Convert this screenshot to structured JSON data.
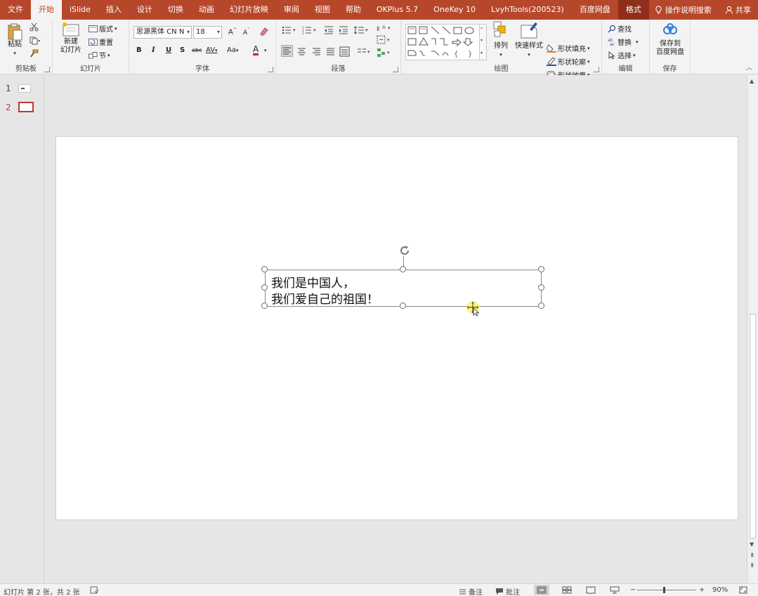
{
  "menu": {
    "tabs": [
      "文件",
      "开始",
      "iSlide",
      "插入",
      "设计",
      "切换",
      "动画",
      "幻灯片放映",
      "审阅",
      "视图",
      "帮助",
      "OKPlus 5.7",
      "OneKey 10",
      "LvyhTools(200523)",
      "百度网盘",
      "格式"
    ],
    "active_index": 1,
    "context_index": 15,
    "help_label": "操作说明搜索",
    "share_label": "共享"
  },
  "ribbon": {
    "clipboard": {
      "paste": "粘贴",
      "label": "剪贴板"
    },
    "slides": {
      "new_slide_line1": "新建",
      "new_slide_line2": "幻灯片",
      "layout": "版式",
      "reset": "重置",
      "section": "节",
      "label": "幻灯片"
    },
    "font": {
      "font_name": "思源黑体 CN N",
      "font_size": "18",
      "bold": "B",
      "italic": "I",
      "underline": "U",
      "shadow": "S",
      "strike": "abc",
      "spacing": "AV",
      "case": "Aa",
      "color": "A",
      "grow": "A",
      "shrink": "A",
      "label": "字体"
    },
    "paragraph": {
      "label": "段落"
    },
    "drawing": {
      "arrange": "排列",
      "quick_styles": "快速样式",
      "fill": "形状填充",
      "outline": "形状轮廓",
      "effects": "形状效果",
      "label": "绘图"
    },
    "editing": {
      "find": "查找",
      "replace": "替换",
      "select": "选择",
      "label": "编辑"
    },
    "save": {
      "line1": "保存到",
      "line2": "百度网盘",
      "label": "保存"
    }
  },
  "thumbnails": [
    {
      "number": "1",
      "current": false
    },
    {
      "number": "2",
      "current": true
    }
  ],
  "slide": {
    "text_lines": [
      "我们是中国人，",
      "我们爱自己的祖国！"
    ]
  },
  "status": {
    "slide_info": "幻灯片 第 2 张，共 2 张",
    "notes": "备注",
    "comments": "批注",
    "zoom_minus": "−",
    "zoom_plus": "+",
    "zoom": "90%"
  },
  "colors": {
    "accent": "#b7472a",
    "context_tab": "#8f2f1b",
    "ribbon_bg": "#f3f3f3",
    "workspace_bg": "#e6e6e6"
  }
}
